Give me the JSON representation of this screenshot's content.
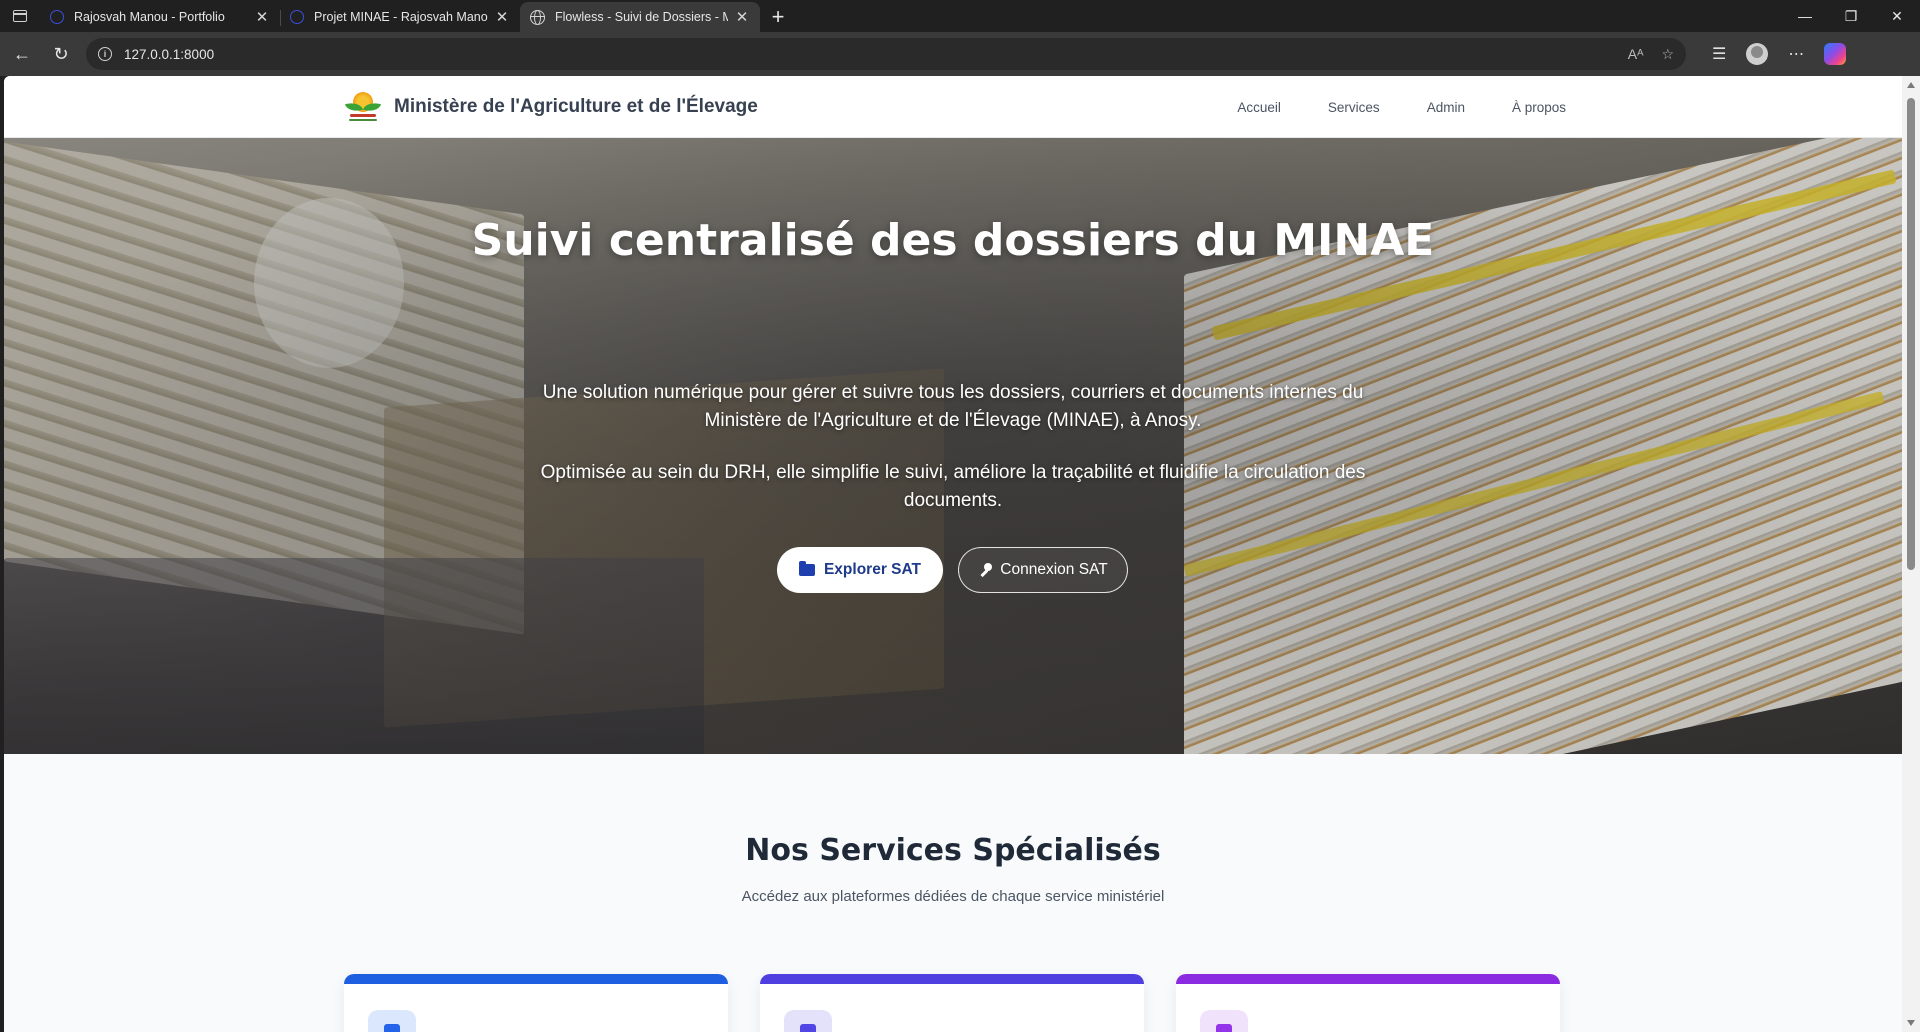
{
  "browser": {
    "tabs": [
      {
        "label": "Rajosvah Manou - Portfolio",
        "close": "✕",
        "active": false
      },
      {
        "label": "Projet MINAE - Rajosvah Manou",
        "close": "✕",
        "active": false
      },
      {
        "label": "Flowless - Suivi de Dossiers - MIN",
        "close": "✕",
        "active": true
      }
    ],
    "new_tab": "+",
    "window_controls": {
      "minimize": "—",
      "restore": "❐",
      "close": "✕"
    },
    "url": "127.0.0.1:8000",
    "nav": {
      "back": "←",
      "reload": "↻"
    },
    "toolbar_icons": [
      "read-aloud-icon",
      "favorite-star-icon",
      "favorites-icon",
      "profile-icon",
      "more-icon",
      "copilot-icon"
    ],
    "toolbar_glyphs": {
      "read_aloud": "Aᴬ",
      "star": "☆",
      "favorites": "☰",
      "more": "⋯"
    }
  },
  "header": {
    "brand": "Ministère de l'Agriculture et de l'Élevage",
    "nav": [
      "Accueil",
      "Services",
      "Admin",
      "À propos"
    ]
  },
  "hero": {
    "title": "Suivi centralisé des dossiers du MINAE",
    "paragraph1": "Une solution numérique pour gérer et suivre tous les dossiers, courriers et documents internes du Ministère de l'Agriculture et de l'Élevage (MINAE), à Anosy.",
    "paragraph2": "Optimisée au sein du DRH, elle simplifie le suivi, améliore la traçabilité et fluidifie la circulation des documents.",
    "primary_button": "Explorer SAT",
    "secondary_button": "Connexion SAT"
  },
  "services": {
    "title": "Nos Services Spécialisés",
    "subtitle": "Accédez aux plateformes dédiées de chaque service ministériel",
    "card_colors": [
      "#1d5fe0",
      "#4f3ee0",
      "#8a2be2"
    ]
  }
}
